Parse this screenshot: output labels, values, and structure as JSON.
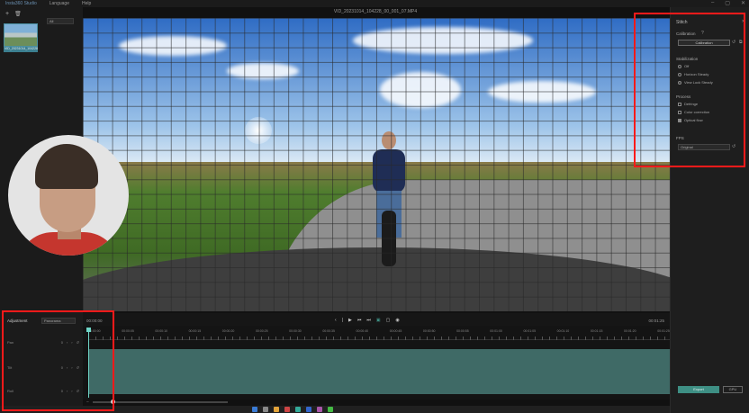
{
  "app": {
    "name": "Insta360 Studio",
    "menu": [
      "Language",
      "Help"
    ],
    "window_controls": [
      "–",
      "▢",
      "✕"
    ],
    "filename": "VID_20231014_104228_00_001_07.MP4"
  },
  "media": {
    "filter": "All",
    "clip_label": "VID_20231014_104228"
  },
  "stitch": {
    "title": "Stitch",
    "calibration_header": "Calibration",
    "calibration_button": "Calibration",
    "stabilization_header": "Stabilization",
    "stabilization_options": [
      {
        "label": "Off",
        "selected": false
      },
      {
        "label": "Horizon Steady",
        "selected": false
      },
      {
        "label": "View Lock Steady",
        "selected": true
      }
    ],
    "process_header": "Process",
    "process_options": [
      {
        "label": "Defringe",
        "checked": false
      },
      {
        "label": "Color correction",
        "checked": false
      },
      {
        "label": "Optical flow",
        "checked": true
      }
    ],
    "fps_header": "FPS",
    "fps_value": "Original",
    "export_label": "Export",
    "gpu_label": "GPU"
  },
  "playback": {
    "current_time": "00:00:00",
    "end_time": "00:01:25"
  },
  "adjustment": {
    "tab": "Adjustment",
    "mode": "Panorama",
    "rows": [
      {
        "label": "Pan",
        "values": [
          "0",
          "‹",
          "›"
        ]
      },
      {
        "label": "Tilt",
        "values": [
          "0",
          "‹",
          "›"
        ]
      },
      {
        "label": "Roll",
        "values": [
          "0",
          "‹",
          "›"
        ]
      }
    ]
  },
  "timeline": {
    "ticks": [
      "00:00:00",
      "00:00:05",
      "00:00:10",
      "00:00:15",
      "00:00:20",
      "00:00:25",
      "00:00:30",
      "00:00:35",
      "00:00:40",
      "00:00:45",
      "00:00:50",
      "00:00:55",
      "00:01:00",
      "00:01:05",
      "00:01:10",
      "00:01:15",
      "00:01:20",
      "00:01:25"
    ]
  },
  "colors": {
    "accent": "#3e8f84",
    "highlight": "#ff1a1a"
  }
}
